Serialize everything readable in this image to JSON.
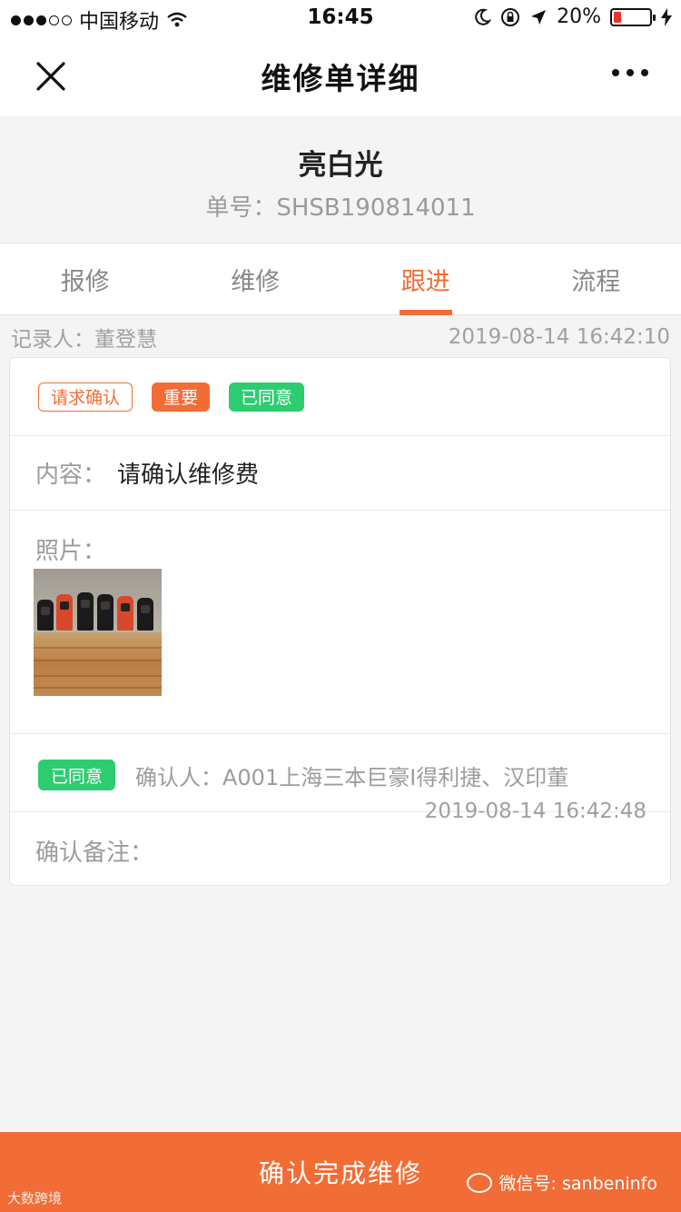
{
  "status_bar": {
    "carrier": "中国移动",
    "time": "16:45",
    "battery": "20%",
    "battery_level": 0.2
  },
  "nav": {
    "title": "维修单详细"
  },
  "header": {
    "title": "亮白光",
    "order_number": "单号：SHSB190814011"
  },
  "tabs": [
    {
      "label": "报修",
      "active": false
    },
    {
      "label": "维修",
      "active": false
    },
    {
      "label": "跟进",
      "active": true
    },
    {
      "label": "流程",
      "active": false
    }
  ],
  "record": {
    "recorder": "记录人：董登慧",
    "timestamp": "2019-08-14 16:42:10"
  },
  "card": {
    "tags": [
      "请求确认",
      "重要",
      "已同意"
    ],
    "content_label": "内容：",
    "content_value": "请确认维修费",
    "photo_label": "照片：",
    "confirm_tag": "已同意",
    "confirm_by": "确认人：A001上海三本巨豪I得利捷、汉印董",
    "confirm_time": "2019-08-14 16:42:48",
    "remark_label": "确认备注："
  },
  "bottom_button": {
    "label": "确认完成维修"
  },
  "watermark": {
    "left": "大数跨境",
    "right": "微信号: sanbeninfo"
  },
  "colors": {
    "accent": "#f26c36",
    "success": "#2ecc71"
  }
}
